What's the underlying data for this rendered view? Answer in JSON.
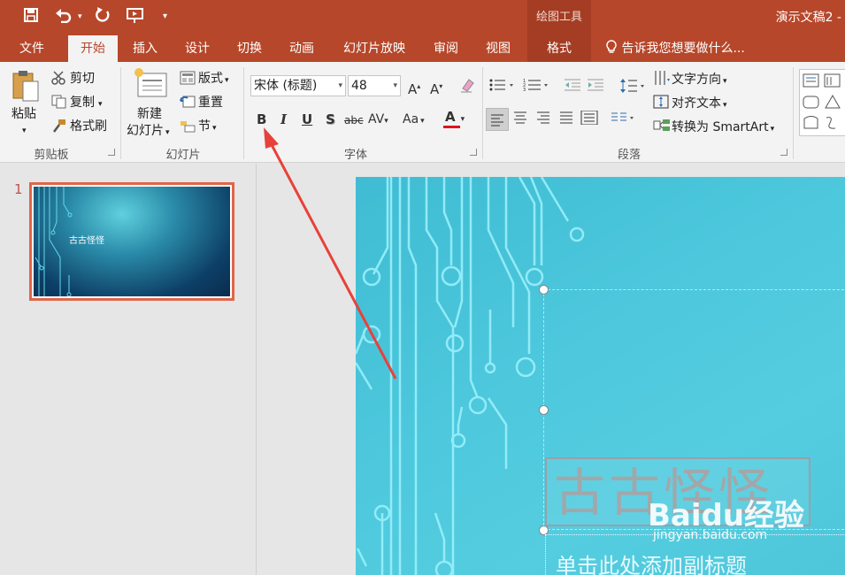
{
  "titlebar": {
    "drawing_tools": "绘图工具",
    "doc_title": "演示文稿2 -"
  },
  "tabs": [
    "文件",
    "开始",
    "插入",
    "设计",
    "切换",
    "动画",
    "幻灯片放映",
    "审阅",
    "视图",
    "格式"
  ],
  "active_tab": "开始",
  "tell_me": "告诉我您想要做什么...",
  "ribbon": {
    "clipboard": {
      "paste": "粘贴",
      "cut": "剪切",
      "copy": "复制",
      "format_painter": "格式刷",
      "label": "剪贴板"
    },
    "slides": {
      "new_slide_1": "新建",
      "new_slide_2": "幻灯片",
      "layout": "版式",
      "reset": "重置",
      "section": "节",
      "label": "幻灯片"
    },
    "font": {
      "family": "宋体 (标题)",
      "size": "48",
      "bold": "B",
      "italic": "I",
      "underline": "U",
      "shadow": "S",
      "strike": "abc",
      "spacing": "AV",
      "case": "Aa",
      "color_a": "A",
      "label": "字体"
    },
    "paragraph": {
      "text_direction": "文字方向",
      "align_text": "对齐文本",
      "smartart": "转换为 SmartArt",
      "label": "段落"
    }
  },
  "slides_pane": {
    "slide_number": "1",
    "thumb_title": "古古怪怪"
  },
  "slide": {
    "title": "古古怪怪",
    "subtitle": "单击此处添加副标题"
  },
  "watermark": {
    "brand": "Baidu经验",
    "url": "jingyan.baidu.com"
  },
  "colors": {
    "titlebar": "#b7472a",
    "arrow": "#e8413a"
  }
}
